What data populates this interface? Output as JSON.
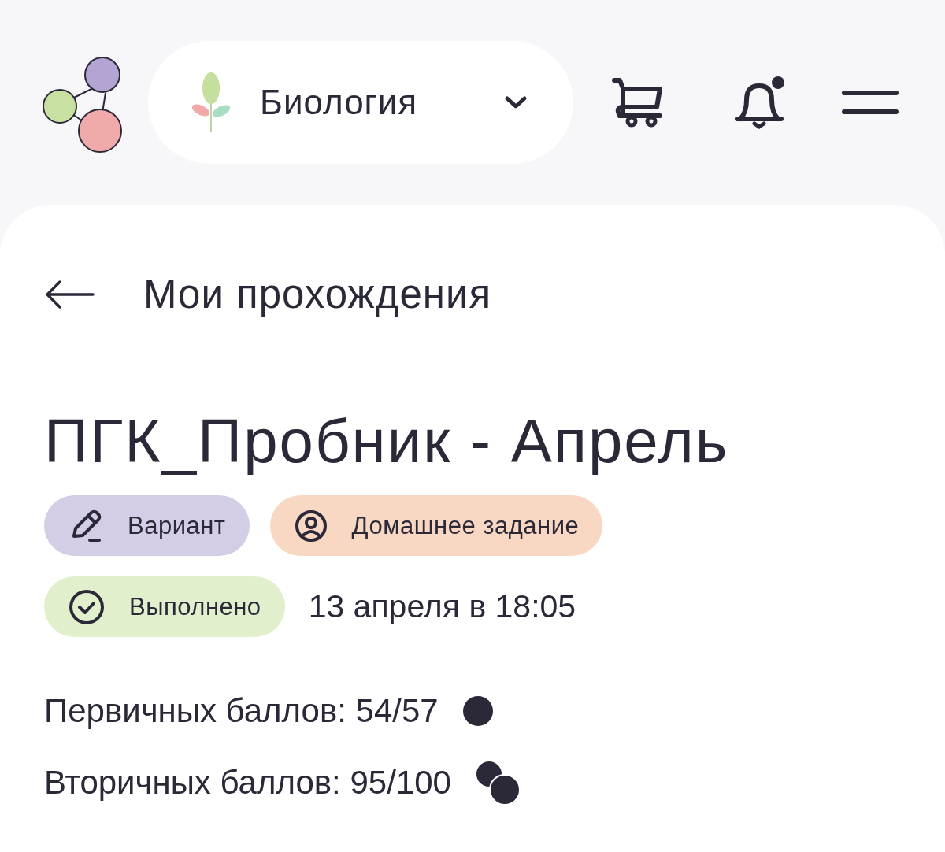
{
  "header": {
    "subject": "Биология",
    "notifications": {
      "unread": true
    }
  },
  "back": {
    "label": "Мои прохождения"
  },
  "title": "ПГК_Пробник - Апрель",
  "tags": [
    {
      "kind": "variant",
      "label": "Вариант",
      "color": "#d3cde6"
    },
    {
      "kind": "homework",
      "label": "Домашнее задание",
      "color": "#f8d7c3"
    },
    {
      "kind": "done",
      "label": "Выполнено",
      "color": "#e1efcc"
    }
  ],
  "date": "13 апреля в 18:05",
  "scores": [
    {
      "kind": "primary",
      "label": "Первичных баллов: 54/57"
    },
    {
      "kind": "secondary",
      "label": "Вторичных баллов: 95/100"
    }
  ]
}
